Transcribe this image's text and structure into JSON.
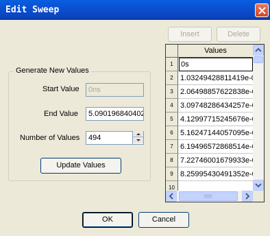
{
  "window": {
    "title": "Edit Sweep"
  },
  "toolbar": {
    "insert_label": "Insert",
    "delete_label": "Delete"
  },
  "generate": {
    "legend": "Generate New Values",
    "start_label": "Start Value",
    "start_value": "0ns",
    "end_label": "End Value",
    "end_value": "5.090196840402",
    "count_label": "Number of Values",
    "count_value": "494",
    "update_label": "Update Values"
  },
  "grid": {
    "header": "Values",
    "rows": [
      {
        "num": "1",
        "value": "0s"
      },
      {
        "num": "2",
        "value": "1.03249428811419e-0"
      },
      {
        "num": "3",
        "value": "2.06498857622838e-0"
      },
      {
        "num": "4",
        "value": "3.09748286434257e-0"
      },
      {
        "num": "5",
        "value": "4.12997715245676e-0"
      },
      {
        "num": "6",
        "value": "5.16247144057095e-0"
      },
      {
        "num": "7",
        "value": "6.19496572868514e-0"
      },
      {
        "num": "8",
        "value": "7.22746001679933e-0"
      },
      {
        "num": "9",
        "value": "8.25995430491352e-0"
      },
      {
        "num": "10",
        "value": ""
      }
    ]
  },
  "footer": {
    "ok_label": "OK",
    "cancel_label": "Cancel"
  }
}
